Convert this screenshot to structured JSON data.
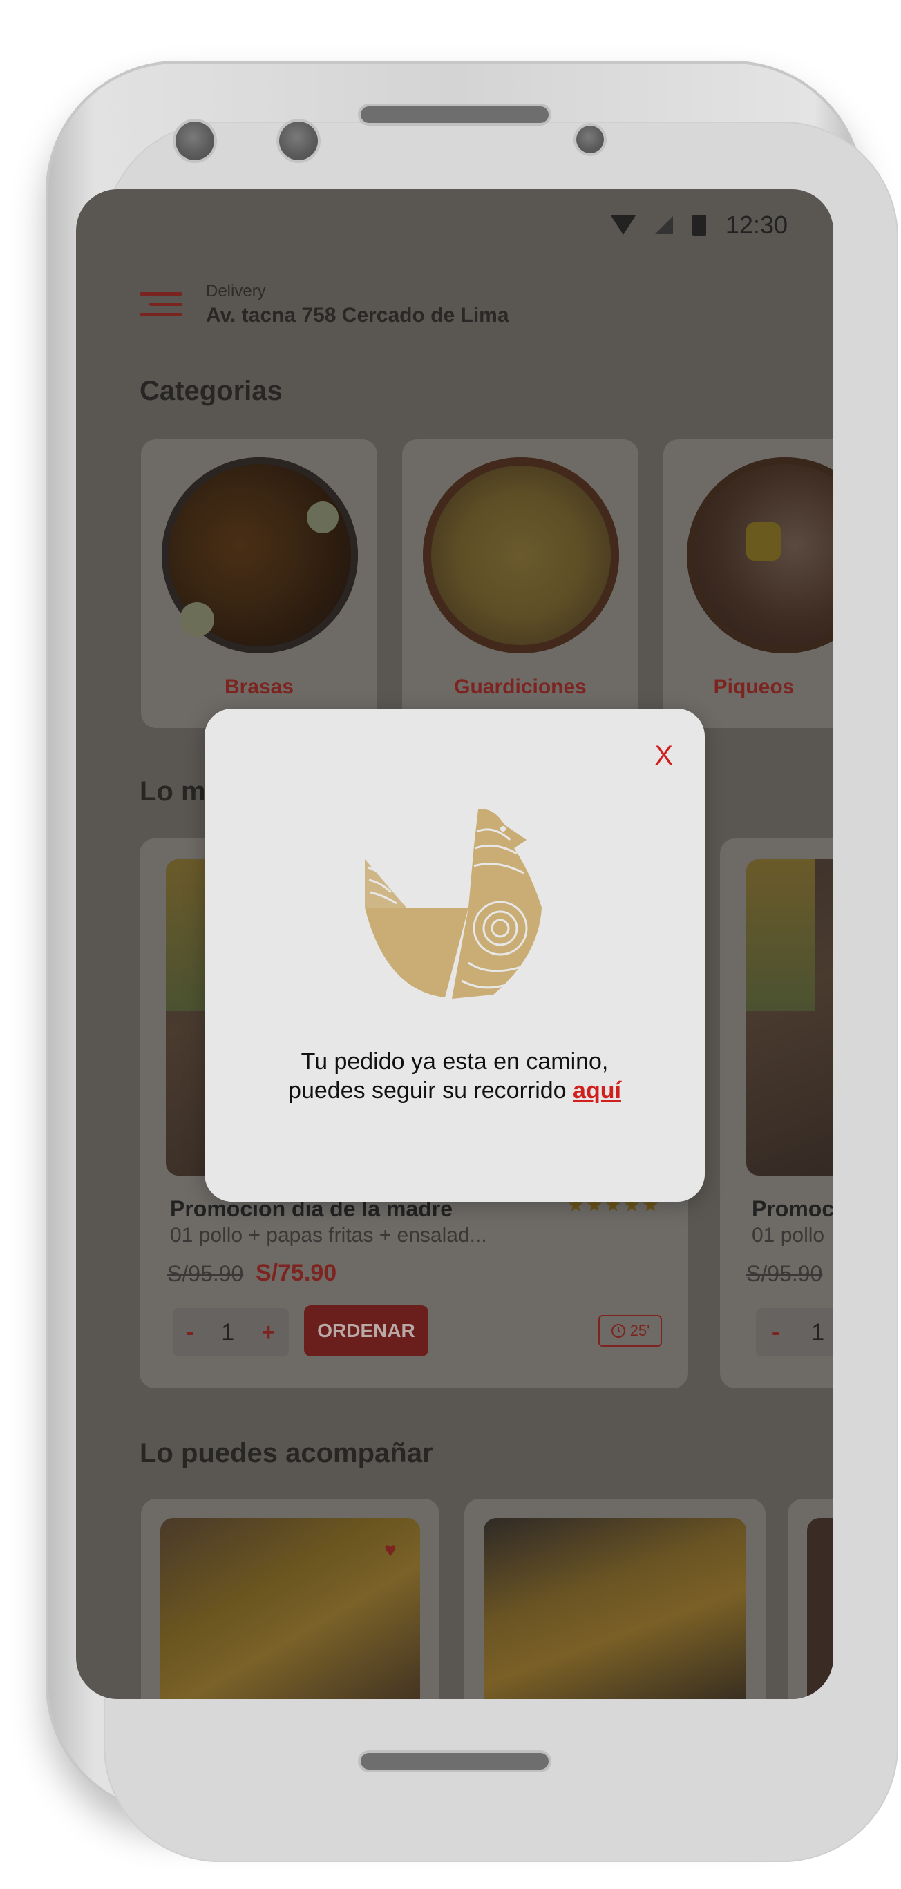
{
  "status_bar": {
    "time": "12:30"
  },
  "header": {
    "mode": "Delivery",
    "address": "Av. tacna 758  Cercado de Lima"
  },
  "categories": {
    "title": "Categorias",
    "items": [
      {
        "label": "Brasas"
      },
      {
        "label": "Guardiciones"
      },
      {
        "label": "Piqueos"
      }
    ]
  },
  "featured": {
    "title_partial": "Lo m",
    "products": [
      {
        "name": "Promocion dia de la madre",
        "description": "01 pollo + papas fritas + ensalad...",
        "old_price": "S/95.90",
        "new_price": "S/75.90",
        "quantity": "1",
        "order_label": "ORDENAR",
        "time": "25'",
        "rating": 5
      },
      {
        "name": "Promoc",
        "description": "01 pollo",
        "old_price": "S/95.90",
        "quantity": "1"
      }
    ]
  },
  "sides": {
    "title": "Lo puedes acompañar"
  },
  "modal": {
    "close_label": "X",
    "line1": "Tu pedido ya esta en camino,",
    "line2": "puedes seguir su recorrido",
    "link": "aquí"
  },
  "colors": {
    "brand_red": "#d0201d",
    "logo_gold": "#c9ad74",
    "overlay": "#5a5753"
  }
}
